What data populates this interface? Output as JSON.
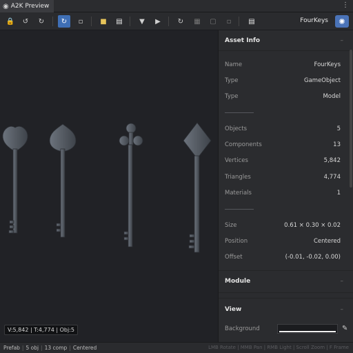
{
  "titlebar": {
    "title": "A2K Preview",
    "menu_glyph": "⋮"
  },
  "toolbar": {
    "buttons": [
      {
        "name": "lock-icon",
        "glyph": "🔒"
      },
      {
        "name": "rotate-ccw-icon",
        "glyph": "↺"
      },
      {
        "name": "rotate-cw-icon",
        "glyph": "↻"
      },
      {
        "name": "refresh-active-icon",
        "glyph": "↻"
      },
      {
        "name": "square-icon",
        "glyph": "▫"
      },
      {
        "name": "folder-icon",
        "glyph": "■"
      },
      {
        "name": "document-icon",
        "glyph": "▤"
      },
      {
        "name": "funnel-icon",
        "glyph": "▼"
      },
      {
        "name": "play-icon",
        "glyph": "▶"
      },
      {
        "name": "reload-icon",
        "glyph": "↻"
      },
      {
        "name": "grid-icon",
        "glyph": "▦"
      },
      {
        "name": "frame-icon",
        "glyph": "▢"
      },
      {
        "name": "small-square-icon",
        "glyph": "▫"
      },
      {
        "name": "page-icon",
        "glyph": "▤"
      }
    ],
    "asset_name": "FourKeys",
    "settings_glyph": "✺"
  },
  "viewport": {
    "stats": "V:5,842 | T:4,774 | Obj:5"
  },
  "inspector": {
    "asset_info": {
      "header": "Asset Info",
      "collapse_glyph": "–",
      "rows": [
        {
          "k": "Name",
          "v": "FourKeys"
        },
        {
          "k": "Type",
          "v": "GameObject"
        },
        {
          "k": "Type",
          "v": "Model"
        }
      ],
      "stats_rows": [
        {
          "k": "Objects",
          "v": "5"
        },
        {
          "k": "Components",
          "v": "13"
        },
        {
          "k": "Vertices",
          "v": "5,842"
        },
        {
          "k": "Triangles",
          "v": "4,774"
        },
        {
          "k": "Materials",
          "v": "1"
        }
      ],
      "geo_rows": [
        {
          "k": "Size",
          "v": "0.61 × 0.30 × 0.02"
        },
        {
          "k": "Position",
          "v": "Centered"
        },
        {
          "k": "Offset",
          "v": "(-0.01, -0.02, 0.00)"
        }
      ]
    },
    "module": {
      "header": "Module",
      "collapse_glyph": "–"
    },
    "view": {
      "header": "View",
      "collapse_glyph": "–",
      "background_label": "Background",
      "picker_glyph": "✎"
    }
  },
  "statusbar": {
    "items": [
      "Prefab",
      "5 obj",
      "13 comp",
      "Centered"
    ],
    "hints": "LMB Rotate | MMB Pan | RMB Light | Scroll Zoom | F Frame"
  },
  "colors": {
    "accent": "#3f6fb5",
    "key_metal": "#5a6069",
    "background": "#212226"
  }
}
